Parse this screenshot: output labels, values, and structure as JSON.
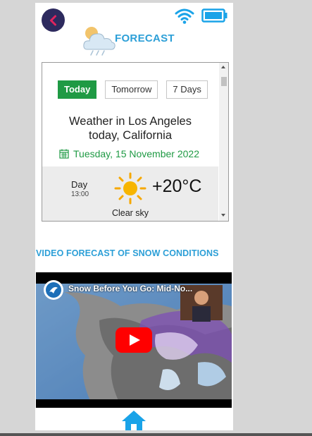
{
  "header": {
    "back_icon": "chevron-left-icon",
    "status_icons": [
      "wifi-icon",
      "battery-icon"
    ],
    "title": "FORECAST",
    "accent_color": "#2c9fd7"
  },
  "widget": {
    "tabs": [
      {
        "label": "Today",
        "active": true
      },
      {
        "label": "Tomorrow",
        "active": false
      },
      {
        "label": "7 Days",
        "active": false
      }
    ],
    "title_line1": "Weather in Los Angeles",
    "title_line2": "today, California",
    "date": "Tuesday, 15 November 2022",
    "period": {
      "label": "Day",
      "time": "13:00",
      "temperature": "+20°C",
      "condition": "Clear sky",
      "icon": "sun-icon"
    },
    "accent_color": "#1f9a44"
  },
  "video": {
    "heading": "VIDEO FORECAST OF SNOW CONDITIONS",
    "title": "Snow Before You Go: Mid-No...",
    "play_icon": "youtube-play-icon"
  },
  "footer": {
    "home_icon": "home-icon"
  }
}
